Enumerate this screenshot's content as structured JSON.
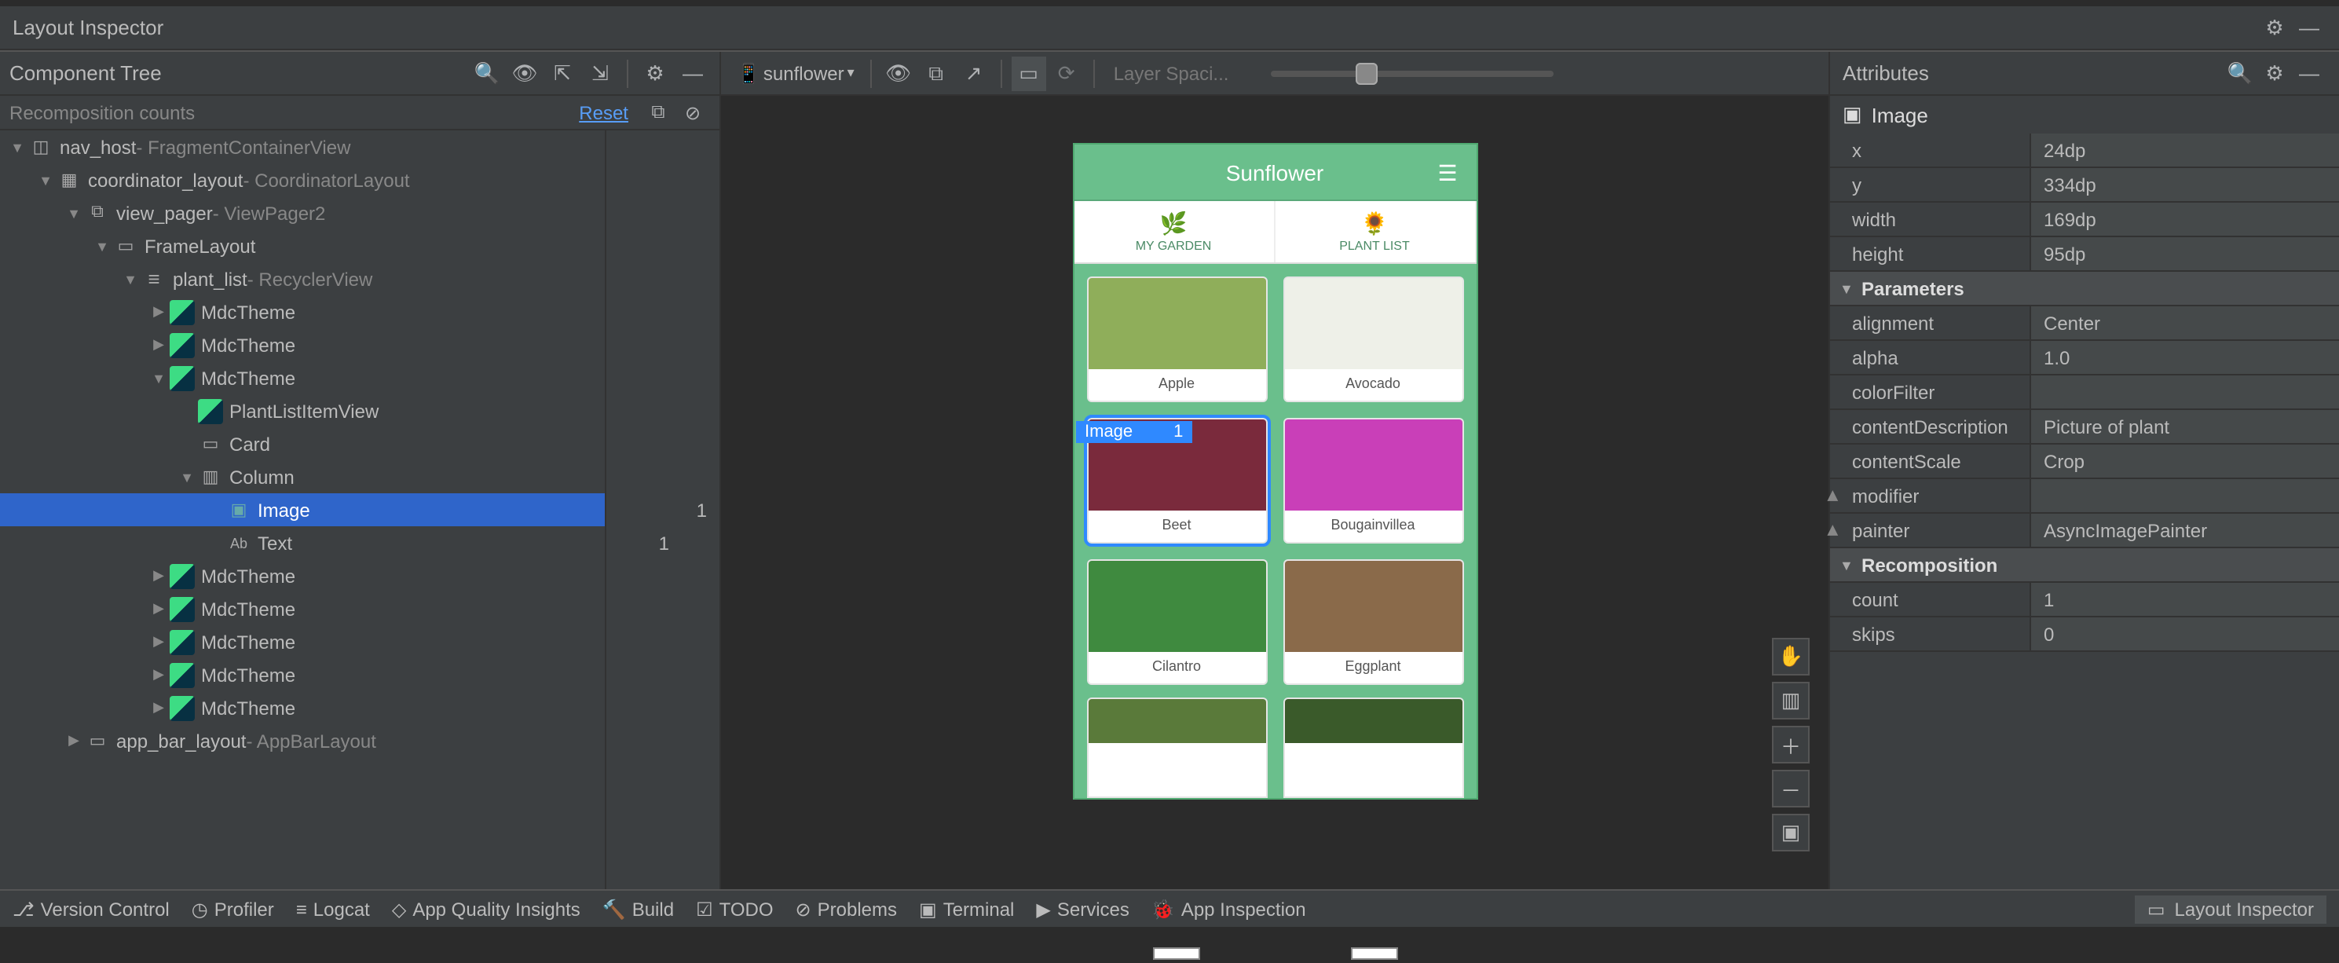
{
  "window": {
    "title": "Layout Inspector"
  },
  "left": {
    "header": "Component Tree",
    "recomp_header": "Recomposition counts",
    "reset": "Reset",
    "tree": [
      {
        "indent": 0,
        "arrow": "down",
        "icon": "nav-badge",
        "name": "nav_host",
        "type": " - FragmentContainerView"
      },
      {
        "indent": 1,
        "arrow": "down",
        "icon": "coord-badge",
        "name": "coordinator_layout",
        "type": " - CoordinatorLayout"
      },
      {
        "indent": 2,
        "arrow": "down",
        "icon": "vp-badge",
        "name": "view_pager",
        "type": " - ViewPager2"
      },
      {
        "indent": 3,
        "arrow": "down",
        "icon": "frame-badge",
        "name": "FrameLayout",
        "type": ""
      },
      {
        "indent": 4,
        "arrow": "down",
        "icon": "list-badge",
        "name": "plant_list",
        "type": " - RecyclerView"
      },
      {
        "indent": 5,
        "arrow": "right",
        "icon": "compose",
        "name": "MdcTheme",
        "type": ""
      },
      {
        "indent": 5,
        "arrow": "right",
        "icon": "compose",
        "name": "MdcTheme",
        "type": ""
      },
      {
        "indent": 5,
        "arrow": "down",
        "icon": "compose",
        "name": "MdcTheme",
        "type": ""
      },
      {
        "indent": 6,
        "arrow": "leaf",
        "icon": "compose",
        "name": "PlantListItemView",
        "type": ""
      },
      {
        "indent": 6,
        "arrow": "leaf",
        "icon": "card-badge",
        "name": "Card",
        "type": ""
      },
      {
        "indent": 6,
        "arrow": "down",
        "icon": "col-badge",
        "name": "Column",
        "type": ""
      },
      {
        "indent": 7,
        "arrow": "leaf",
        "icon": "img-badge",
        "name": "Image",
        "type": "",
        "selected": true,
        "count1": "1"
      },
      {
        "indent": 7,
        "arrow": "leaf",
        "icon": "text-badge",
        "name": "Text",
        "type": "",
        "count2": "1"
      },
      {
        "indent": 5,
        "arrow": "right",
        "icon": "compose",
        "name": "MdcTheme",
        "type": ""
      },
      {
        "indent": 5,
        "arrow": "right",
        "icon": "compose",
        "name": "MdcTheme",
        "type": ""
      },
      {
        "indent": 5,
        "arrow": "right",
        "icon": "compose",
        "name": "MdcTheme",
        "type": ""
      },
      {
        "indent": 5,
        "arrow": "right",
        "icon": "compose",
        "name": "MdcTheme",
        "type": ""
      },
      {
        "indent": 5,
        "arrow": "right",
        "icon": "compose",
        "name": "MdcTheme",
        "type": ""
      },
      {
        "indent": 2,
        "arrow": "right",
        "icon": "appbar-badge",
        "name": "app_bar_layout",
        "type": " - AppBarLayout"
      }
    ]
  },
  "center": {
    "device": "sunflower",
    "layer_label": "Layer Spaci...",
    "phone_title": "Sunflower",
    "tab1": "MY GARDEN",
    "tab2": "PLANT LIST",
    "cards": [
      {
        "label": "Apple",
        "color": "#8fae5a"
      },
      {
        "label": "Avocado",
        "color": "#eef0e8"
      },
      {
        "label": "Beet",
        "color": "#7a2a3c",
        "selected": true
      },
      {
        "label": "Bougainvillea",
        "color": "#c93fb8"
      },
      {
        "label": "Cilantro",
        "color": "#3f8a3f"
      },
      {
        "label": "Eggplant",
        "color": "#8a6a4a"
      }
    ],
    "partial": [
      {
        "color": "#5a7a3a"
      },
      {
        "color": "#3a5a2a"
      }
    ],
    "sel_overlay": {
      "text": "Image",
      "badge": "1"
    }
  },
  "right": {
    "header": "Attributes",
    "title": "Image",
    "rows_basic": [
      {
        "k": "x",
        "v": "24dp"
      },
      {
        "k": "y",
        "v": "334dp"
      },
      {
        "k": "width",
        "v": "169dp"
      },
      {
        "k": "height",
        "v": "95dp"
      }
    ],
    "section_params": "Parameters",
    "rows_params": [
      {
        "k": "alignment",
        "v": "Center"
      },
      {
        "k": "alpha",
        "v": "1.0"
      },
      {
        "k": "colorFilter",
        "v": ""
      },
      {
        "k": "contentDescription",
        "v": "Picture of plant"
      },
      {
        "k": "contentScale",
        "v": "Crop"
      },
      {
        "k": "modifier",
        "v": "",
        "expandable": true
      },
      {
        "k": "painter",
        "v": "AsyncImagePainter",
        "expandable": true
      }
    ],
    "section_recomp": "Recomposition",
    "rows_recomp": [
      {
        "k": "count",
        "v": "1"
      },
      {
        "k": "skips",
        "v": "0"
      }
    ]
  },
  "bottom": {
    "items": [
      "Version Control",
      "Profiler",
      "Logcat",
      "App Quality Insights",
      "Build",
      "TODO",
      "Problems",
      "Terminal",
      "Services",
      "App Inspection"
    ],
    "right": "Layout Inspector"
  }
}
